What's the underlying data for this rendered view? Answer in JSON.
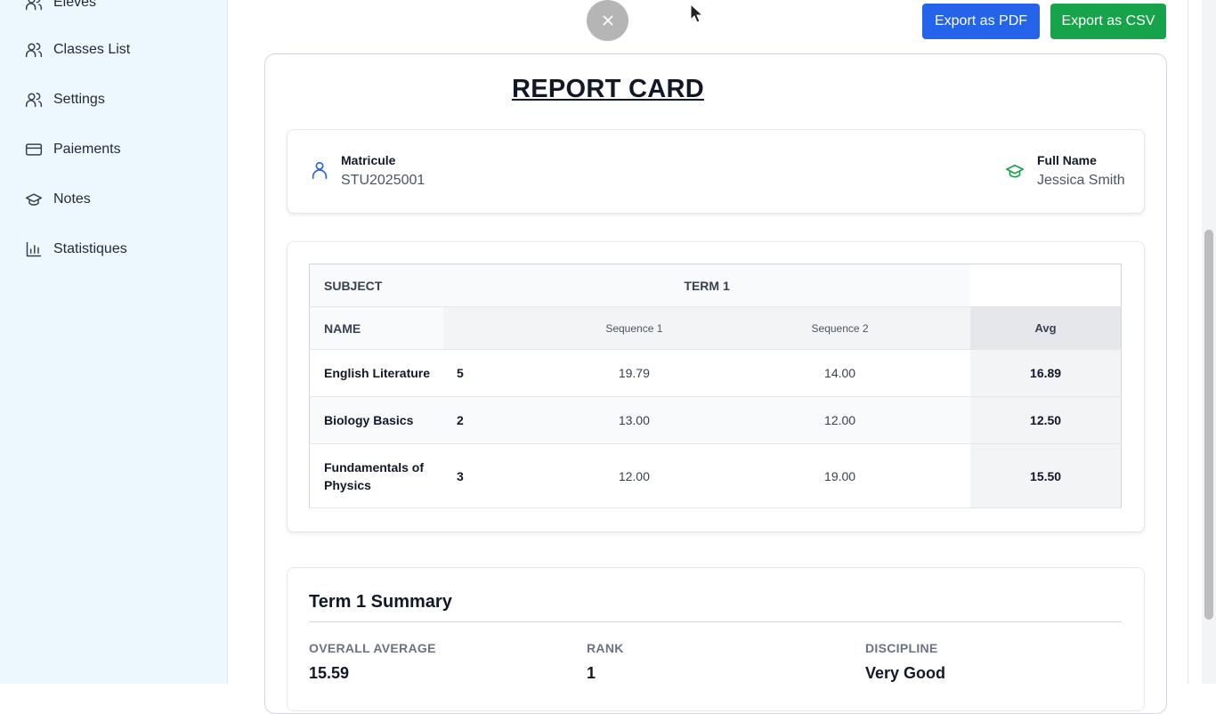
{
  "sidebar": {
    "items": [
      {
        "label": "Eleves",
        "icon": "users-icon"
      },
      {
        "label": "Classes List",
        "icon": "users-icon"
      },
      {
        "label": "Settings",
        "icon": "users-icon"
      },
      {
        "label": "Paiements",
        "icon": "credit-card-icon"
      },
      {
        "label": "Notes",
        "icon": "graduation-cap-icon"
      },
      {
        "label": "Statistiques",
        "icon": "bar-chart-icon"
      }
    ]
  },
  "toolbar": {
    "export_pdf": "Export as PDF",
    "export_csv": "Export as CSV",
    "close_icon": "close-icon",
    "pdf_color": "#2563eb",
    "csv_color": "#16a34a"
  },
  "report": {
    "title": "REPORT CARD",
    "matricule_label": "Matricule",
    "matricule_value": "STU2025001",
    "fullname_label": "Full Name",
    "fullname_value": "Jessica Smith"
  },
  "table": {
    "subject_header": "SUBJECT",
    "term_header": "TERM 1",
    "name_header": "NAME",
    "seq1_header": "Sequence 1",
    "seq2_header": "Sequence 2",
    "avg_header": "Avg",
    "rows": [
      {
        "subject": "English Literature",
        "coef": "5",
        "seq1": "19.79",
        "seq2": "14.00",
        "avg": "16.89"
      },
      {
        "subject": "Biology Basics",
        "coef": "2",
        "seq1": "13.00",
        "seq2": "12.00",
        "avg": "12.50"
      },
      {
        "subject": "Fundamentals of Physics",
        "coef": "3",
        "seq1": "12.00",
        "seq2": "19.00",
        "avg": "15.50"
      }
    ]
  },
  "summary": {
    "title": "Term 1 Summary",
    "overall_label": "OVERALL AVERAGE",
    "overall_value": "15.59",
    "rank_label": "RANK",
    "rank_value": "1",
    "discipline_label": "DISCIPLINE",
    "discipline_value": "Very Good"
  }
}
